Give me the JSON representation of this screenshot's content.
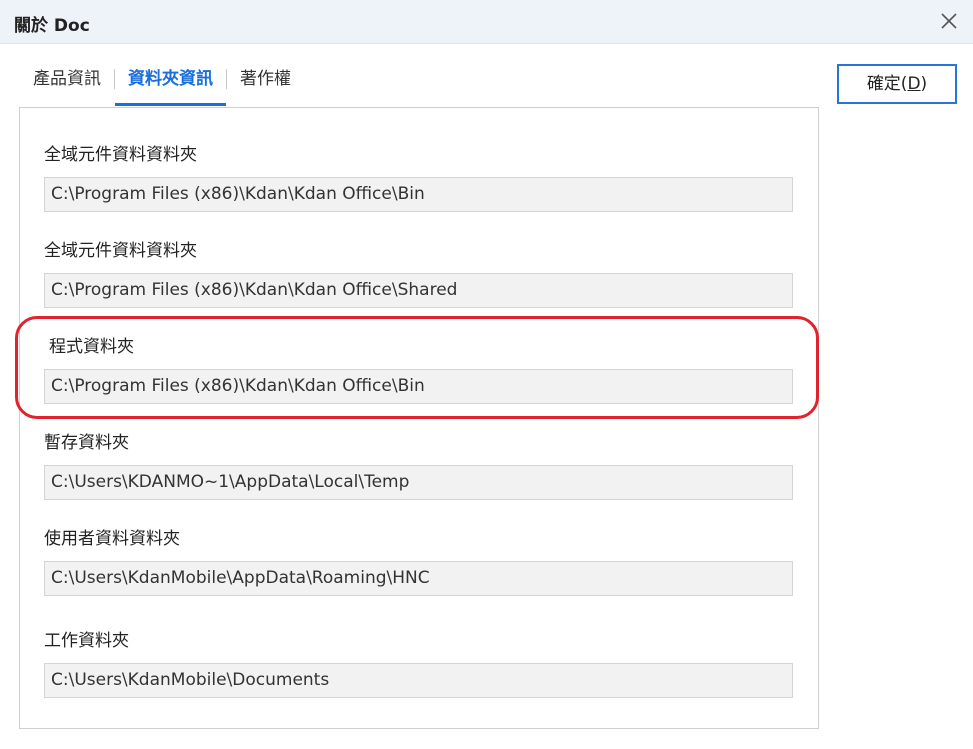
{
  "dialog": {
    "title": "關於 Doc",
    "close_icon": "close-icon"
  },
  "tabs": [
    {
      "label": "產品資訊",
      "active": false
    },
    {
      "label": "資料夾資訊",
      "active": true
    },
    {
      "label": "著作權",
      "active": false
    }
  ],
  "ok_button": {
    "label": "確定(",
    "mnemonic": "D",
    "suffix": ")"
  },
  "folders": [
    {
      "label": "全域元件資料資料夾",
      "value": "C:\\Program Files (x86)\\Kdan\\Kdan Office\\Bin"
    },
    {
      "label": "全域元件資料資料夾",
      "value": "C:\\Program Files (x86)\\Kdan\\Kdan Office\\Shared"
    },
    {
      "label": "程式資料夾",
      "value": "C:\\Program Files (x86)\\Kdan\\Kdan Office\\Bin"
    },
    {
      "label": "暫存資料夾",
      "value": "C:\\Users\\KDANMO~1\\AppData\\Local\\Temp"
    },
    {
      "label": "使用者資料資料夾",
      "value": "C:\\Users\\KdanMobile\\AppData\\Roaming\\HNC"
    },
    {
      "label": "工作資料夾",
      "value": "C:\\Users\\KdanMobile\\Documents"
    }
  ],
  "colors": {
    "accent": "#1a6fe0",
    "highlight": "#e0232e"
  }
}
